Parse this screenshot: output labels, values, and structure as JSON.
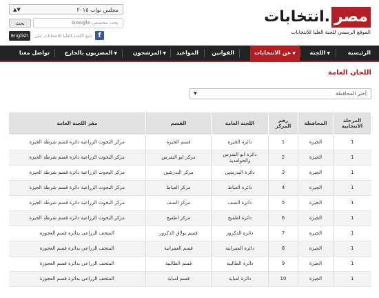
{
  "header": {
    "logo_red": "مصر",
    "logo_black": "انتخابات.",
    "logo_subtitle": "الموقع الرسمي للجنة العليا للانتخابات",
    "election_select": "مجلس نواب ٢٠١٥",
    "search_placeholder": "بحث مخصص",
    "search_google": "Google",
    "search_button": "بحث",
    "english_button": "English",
    "facebook_like": "تابع اللجنة العليا للانتخابات على"
  },
  "nav": {
    "items": [
      {
        "label": "الرئيسية"
      },
      {
        "label": "اللجنة"
      },
      {
        "label": "عن الانتخابات"
      },
      {
        "label": "القوانين"
      },
      {
        "label": "المواعيد"
      },
      {
        "label": "المرشحون"
      },
      {
        "label": "المصريون بالخارج"
      },
      {
        "label": "تواصل معنا"
      }
    ]
  },
  "page": {
    "title": "اللجان العامة",
    "filter_value": "أختر المحافظة"
  },
  "table": {
    "headers": [
      "المرحلة الانتخابية",
      "المحافظة",
      "رقم المركز",
      "اللجنة العامة",
      "القسم",
      "مقر اللجنة العامة"
    ],
    "rows": [
      [
        "1",
        "الجيزة",
        "1",
        "دائرة الجيزة",
        "قسم الجيزة",
        "مركز البحوث الزراعية دائرة قسم شرطة الجيزة"
      ],
      [
        "1",
        "الجيزة",
        "2",
        "دائرة ابو النمرس والحوامدية",
        "مركز ابو النمرس",
        "مركز البحوث الزراعية دائرة قسم شرطة الجيزة"
      ],
      [
        "1",
        "الجيزة",
        "3",
        "دائرة البدرشين",
        "مركز البدرشين",
        "مركز البحوث الزراعية دائرة قسم شرطة الجيزة"
      ],
      [
        "1",
        "الجيزة",
        "4",
        "دائرة العياط",
        "مركز العياط",
        "مركز البحوث الزراعية دائرة قسم شرطة الجيزة"
      ],
      [
        "1",
        "الجيزة",
        "5",
        "دائرة الصف",
        "مركز الصف",
        "مركز البحوث الزراعية دائرة قسم شرطة الجيزة"
      ],
      [
        "1",
        "الجيزة",
        "6",
        "دائرة اطفيح",
        "مركز اطفيح",
        "مركز البحوث الزراعية دائرة قسم شرطة الجيزة"
      ],
      [
        "1",
        "الجيزة",
        "7",
        "دائرة الدكرور",
        "قسم بولاق الدكرور",
        "المتحف الزراعى بدائرة قسم العجوزة"
      ],
      [
        "1",
        "الجيزة",
        "8",
        "دائرة العمرانية",
        "قسم العمرانية",
        "المتحف الزراعى بدائرة قسم العجوزة"
      ],
      [
        "1",
        "الجيزة",
        "9",
        "دائرة الطالبية",
        "قسم الطالبية",
        "المتحف الزراعى بدائرة قسم العجوزة"
      ],
      [
        "1",
        "الجيزة",
        "10",
        "دائرة امبابة",
        "قسم امبابة",
        "المتحف الزراعى بدائرة قسم العجوزة"
      ]
    ]
  }
}
